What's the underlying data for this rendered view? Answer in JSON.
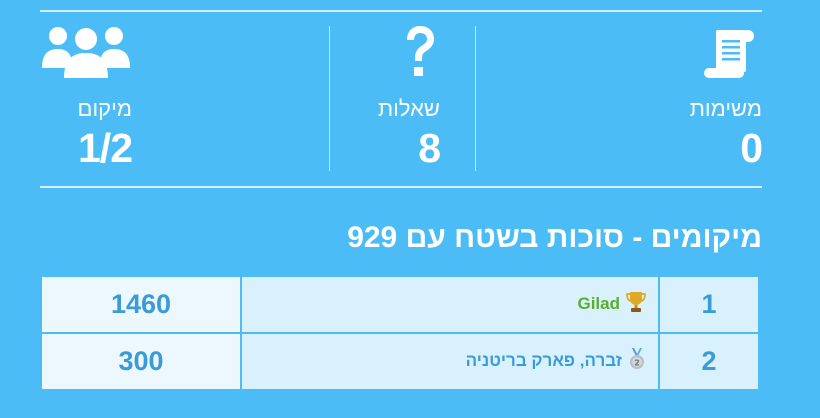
{
  "stats": {
    "tasks": {
      "label": "משימות",
      "value": "0",
      "icon": "scroll-icon"
    },
    "questions": {
      "label": "שאלות",
      "value": "8",
      "icon": "question-mark-icon"
    },
    "place": {
      "label": "מיקום",
      "value": "1/2",
      "icon": "users-group-icon"
    }
  },
  "rankings": {
    "title": "מיקומים - סוכות בשטח עם 929",
    "rows": [
      {
        "rank": "1",
        "team": "Gilad",
        "score": "1460",
        "medal": "trophy-icon",
        "color": "#5aae2e"
      },
      {
        "rank": "2",
        "team": "זברה, פארק בריטניה",
        "score": "300",
        "medal": "silver-medal-icon",
        "color": "#3b9bd8"
      }
    ]
  },
  "colors": {
    "background": "#4bbcf5",
    "divider": "#cdeefd",
    "cell": "#d9f1fd",
    "score_cell": "#ecf8fe",
    "accent": "#3b9bd8"
  }
}
